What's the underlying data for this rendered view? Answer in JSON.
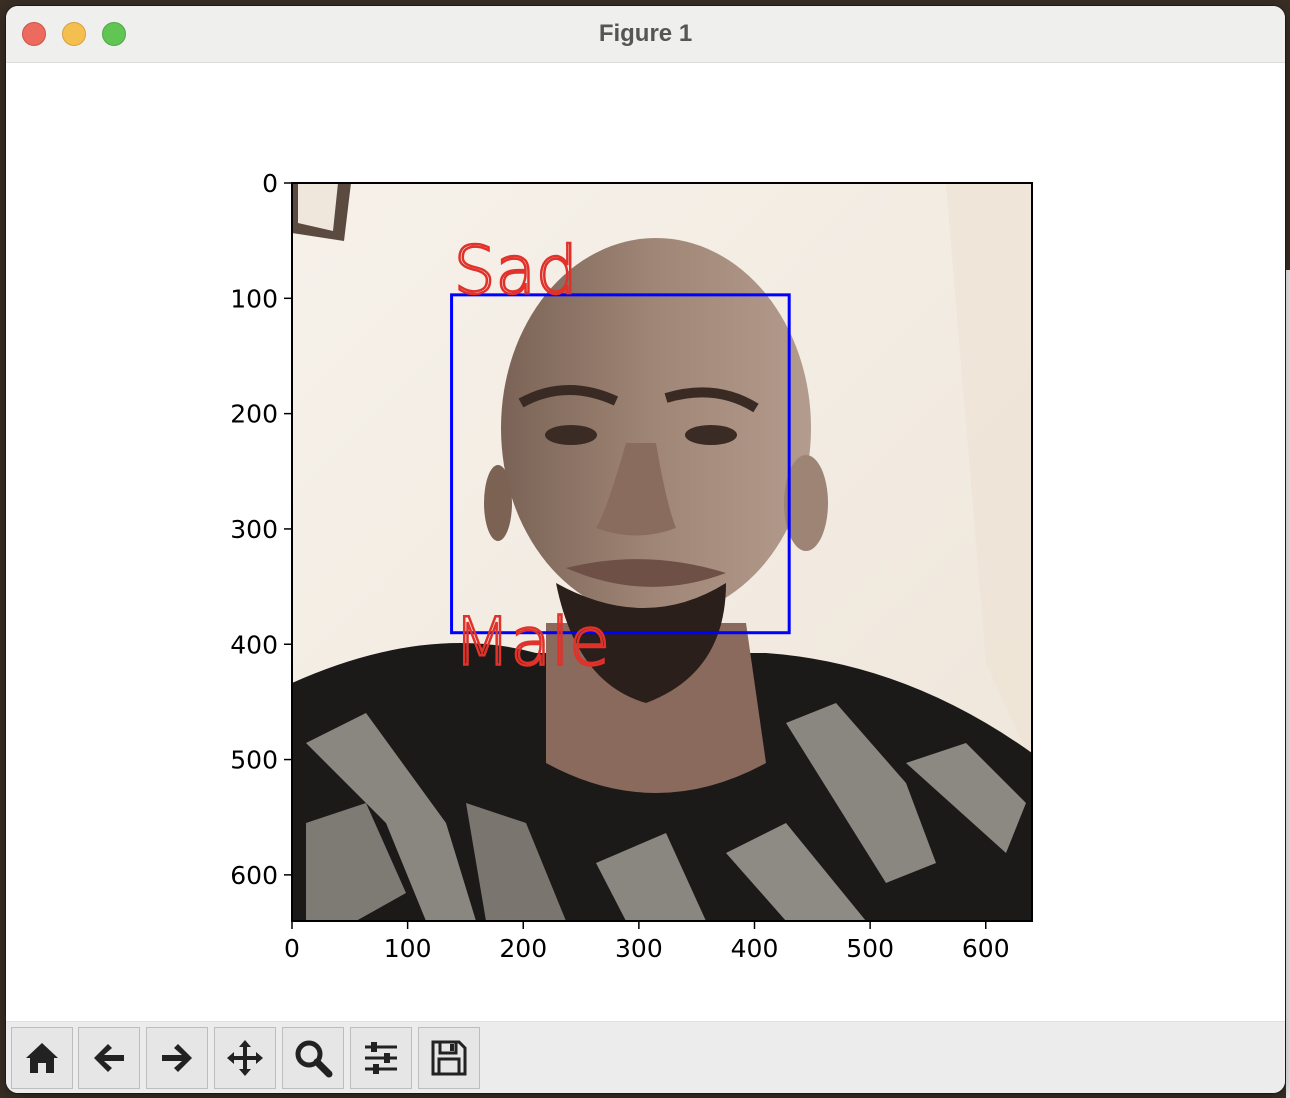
{
  "window": {
    "title": "Figure 1"
  },
  "figure": {
    "annotations": {
      "top_label": "Sad",
      "bottom_label": "Male"
    },
    "bbox_color": "#0000ff",
    "label_color": "#e0322a",
    "image_description_hint": "photo",
    "xlim": [
      0,
      640
    ],
    "ylim": [
      640,
      0
    ]
  },
  "chart_data": {
    "type": "image",
    "x_ticks": [
      "0",
      "100",
      "200",
      "300",
      "400",
      "500",
      "600"
    ],
    "y_ticks": [
      "0",
      "100",
      "200",
      "300",
      "400",
      "500",
      "600"
    ],
    "x_tick_values": [
      0,
      100,
      200,
      300,
      400,
      500,
      600
    ],
    "y_tick_values": [
      0,
      100,
      200,
      300,
      400,
      500,
      600
    ],
    "xlim": [
      0,
      640
    ],
    "ylim": [
      640,
      0
    ],
    "box": {
      "x0": 138,
      "y0": 97,
      "x1": 430,
      "y1": 390
    },
    "grid": false
  },
  "toolbar": {
    "buttons": [
      {
        "name": "home-button",
        "icon": "home-icon"
      },
      {
        "name": "back-button",
        "icon": "arrow-left-icon"
      },
      {
        "name": "forward-button",
        "icon": "arrow-right-icon"
      },
      {
        "name": "pan-button",
        "icon": "move-icon"
      },
      {
        "name": "zoom-button",
        "icon": "magnifier-icon"
      },
      {
        "name": "configure-subplots-button",
        "icon": "sliders-icon"
      },
      {
        "name": "save-button",
        "icon": "floppy-icon"
      }
    ]
  }
}
